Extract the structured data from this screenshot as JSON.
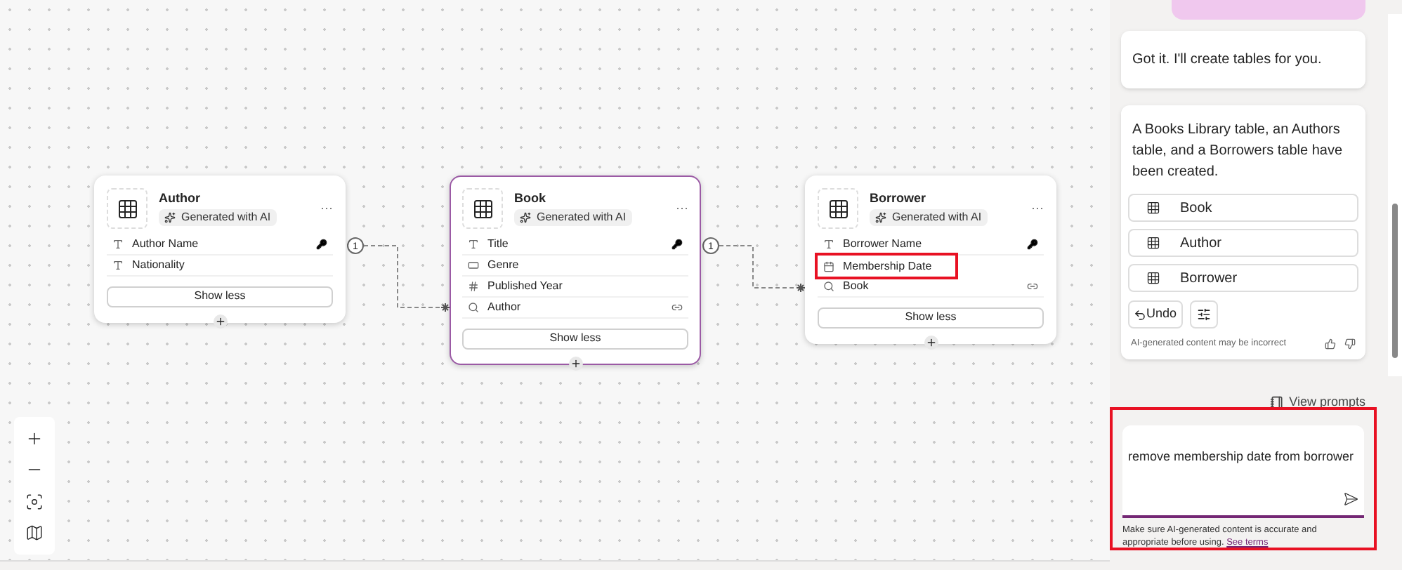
{
  "canvas": {
    "tables": [
      {
        "name": "Author",
        "badge": "Generated with AI",
        "menu": "···",
        "selected": false,
        "toggle": "Show less",
        "fields": [
          {
            "kind": "text",
            "name": "Author Name",
            "primary_key": true,
            "lookup": false,
            "highlighted": false
          },
          {
            "kind": "text",
            "name": "Nationality",
            "primary_key": false,
            "lookup": false,
            "highlighted": false
          }
        ]
      },
      {
        "name": "Book",
        "badge": "Generated with AI",
        "menu": "···",
        "selected": true,
        "toggle": "Show less",
        "fields": [
          {
            "kind": "text",
            "name": "Title",
            "primary_key": true,
            "lookup": false,
            "highlighted": false
          },
          {
            "kind": "choice",
            "name": "Genre",
            "primary_key": false,
            "lookup": false,
            "highlighted": false
          },
          {
            "kind": "number",
            "name": "Published Year",
            "primary_key": false,
            "lookup": false,
            "highlighted": false
          },
          {
            "kind": "lookup",
            "name": "Author",
            "primary_key": false,
            "lookup": true,
            "highlighted": false
          }
        ]
      },
      {
        "name": "Borrower",
        "badge": "Generated with AI",
        "menu": "···",
        "selected": false,
        "toggle": "Show less",
        "fields": [
          {
            "kind": "text",
            "name": "Borrower Name",
            "primary_key": true,
            "lookup": false,
            "highlighted": false
          },
          {
            "kind": "date",
            "name": "Membership Date",
            "primary_key": false,
            "lookup": false,
            "highlighted": true
          },
          {
            "kind": "lookup",
            "name": "Book",
            "primary_key": false,
            "lookup": true,
            "highlighted": false
          }
        ]
      }
    ],
    "relationships": [
      {
        "one_label": "1"
      },
      {
        "one_label": "1"
      }
    ]
  },
  "chat": {
    "messages": [
      {
        "kind": "bubble",
        "text": "Got it. I'll create tables for you."
      },
      {
        "kind": "result",
        "text": "A Books Library table, an Authors table, and a Borrowers table have been created.",
        "tables": [
          "Book",
          "Author",
          "Borrower"
        ],
        "undo": "Undo",
        "disclaimer": "AI-generated content may be incorrect"
      }
    ],
    "view_prompts": "View prompts",
    "input": {
      "value": "remove membership date from borrower",
      "highlighted": true
    },
    "footer": {
      "text": "Make sure AI-generated content is accurate and appropriate before using.",
      "link": "See terms"
    }
  }
}
